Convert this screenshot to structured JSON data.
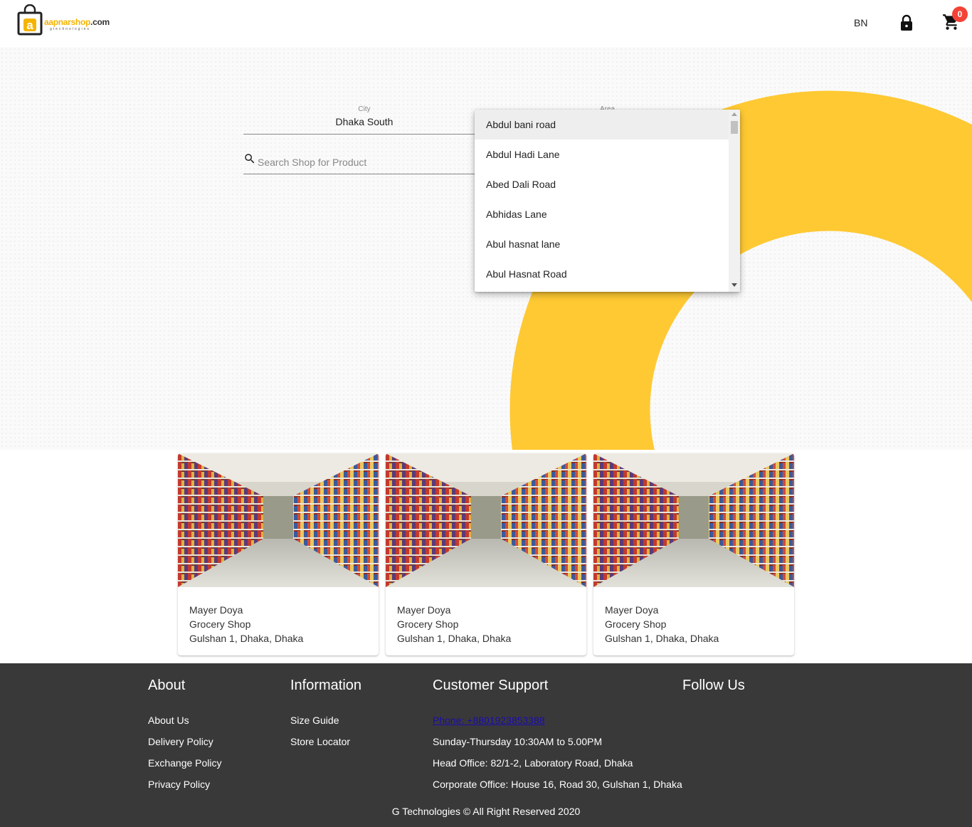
{
  "header": {
    "logo_text": "aapnarshop",
    "logo_domain": ".com",
    "logo_sub": "gtechnologies",
    "lang_label": "BN",
    "cart_count": "0"
  },
  "filters": {
    "city_label": "City",
    "city_value": "Dhaka South",
    "area_label": "Area",
    "search_placeholder": "Search Shop for Product"
  },
  "area_dropdown": {
    "options": [
      "Abdul bani road",
      "Abdul Hadi Lane",
      "Abed Dali Road",
      "Abhidas Lane",
      "Abul hasnat lane",
      "Abul Hasnat Road"
    ],
    "selected_index": 0
  },
  "shops": [
    {
      "name": "Mayer Doya",
      "type": "Grocery Shop",
      "location": "Gulshan 1, Dhaka, Dhaka"
    },
    {
      "name": "Mayer Doya",
      "type": "Grocery Shop",
      "location": "Gulshan 1, Dhaka, Dhaka"
    },
    {
      "name": "Mayer Doya",
      "type": "Grocery Shop",
      "location": "Gulshan 1, Dhaka, Dhaka"
    }
  ],
  "footer": {
    "about": {
      "heading": "About",
      "links": [
        "About Us",
        "Delivery Policy",
        "Exchange Policy",
        "Privacy Policy"
      ]
    },
    "information": {
      "heading": "Information",
      "links": [
        "Size Guide",
        "Store Locator"
      ]
    },
    "support": {
      "heading": "Customer Support",
      "phone": "Phone: +8801923853388",
      "hours": "Sunday-Thursday 10:30AM to 5.00PM",
      "head_office": "Head Office: 82/1-2, Laboratory Road, Dhaka",
      "corporate_office": "Corporate Office: House 16, Road 30, Gulshan 1, Dhaka"
    },
    "follow": {
      "heading": "Follow Us"
    },
    "copyright": "G Technologies © All Right Reserved 2020"
  },
  "colors": {
    "accent": "#ffc933",
    "footer_bg": "#3a3939",
    "badge": "#f44336"
  }
}
